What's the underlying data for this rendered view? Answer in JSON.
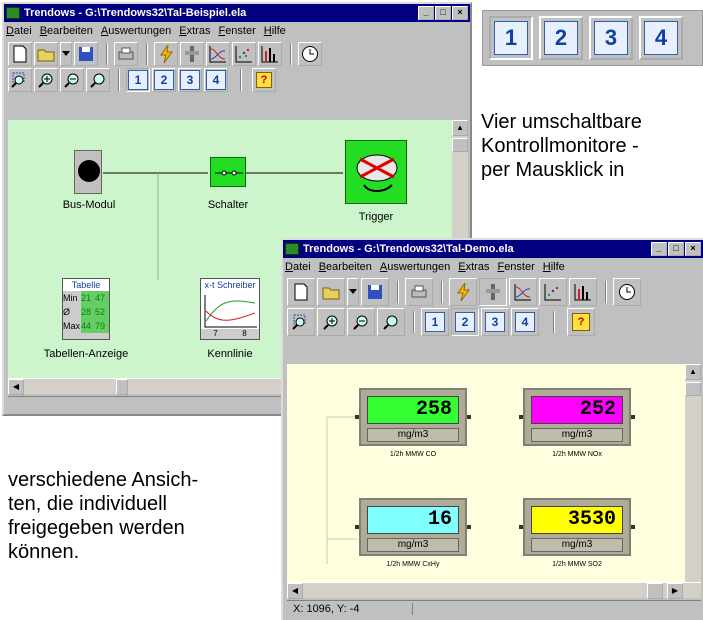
{
  "window1": {
    "title": "Trendows - G:\\Trendows32\\Tal-Beispiel.ela",
    "menu": [
      "Datei",
      "Bearbeiten",
      "Auswertungen",
      "Extras",
      "Fenster",
      "Hilfe"
    ],
    "monitor_buttons": [
      "1",
      "2",
      "3",
      "4"
    ],
    "help_button": "?",
    "nodes": {
      "bus_modul": "Bus-Modul",
      "schalter": "Schalter",
      "trigger": "Trigger",
      "tabellen_anzeige": "Tabellen-Anzeige",
      "kennlinie": "Kennlinie"
    },
    "table_widget": {
      "header": "Tabelle",
      "rows": [
        {
          "label": "Min",
          "a": "21",
          "b": "47"
        },
        {
          "label": "Ø",
          "a": "28",
          "b": "52"
        },
        {
          "label": "Max",
          "a": "44",
          "b": "79"
        }
      ]
    },
    "chart_widget": {
      "header": "x-t Schreiber",
      "ticks": [
        "7",
        "8"
      ]
    }
  },
  "monitor_strip": [
    "1",
    "2",
    "3",
    "4"
  ],
  "caption_right": [
    "Vier umschaltbare",
    "Kontrollmonitore -",
    "per Mausklick in"
  ],
  "caption_left": [
    "verschiedene Ansich-",
    "ten, die individuell",
    "freigegeben werden",
    "können."
  ],
  "window2": {
    "title": "Trendows - G:\\Trendows32\\Tal-Demo.ela",
    "menu": [
      "Datei",
      "Bearbeiten",
      "Auswertungen",
      "Extras",
      "Fenster",
      "Hilfe"
    ],
    "monitor_buttons": [
      "1",
      "2",
      "3",
      "4"
    ],
    "help_button": "?",
    "status": "X: 1096, Y:  -4",
    "displays": [
      {
        "value": "258",
        "unit": "mg/m3",
        "label": "1/2h MMW CO",
        "color": "#33ff33"
      },
      {
        "value": "252",
        "unit": "mg/m3",
        "label": "1/2h MMW NOx",
        "color": "#ff00ff"
      },
      {
        "value": "16",
        "unit": "mg/m3",
        "label": "1/2h MMW CxHy",
        "color": "#80ffff"
      },
      {
        "value": "3530",
        "unit": "mg/m3",
        "label": "1/2h MMW SO2",
        "color": "#ffff00"
      }
    ]
  }
}
